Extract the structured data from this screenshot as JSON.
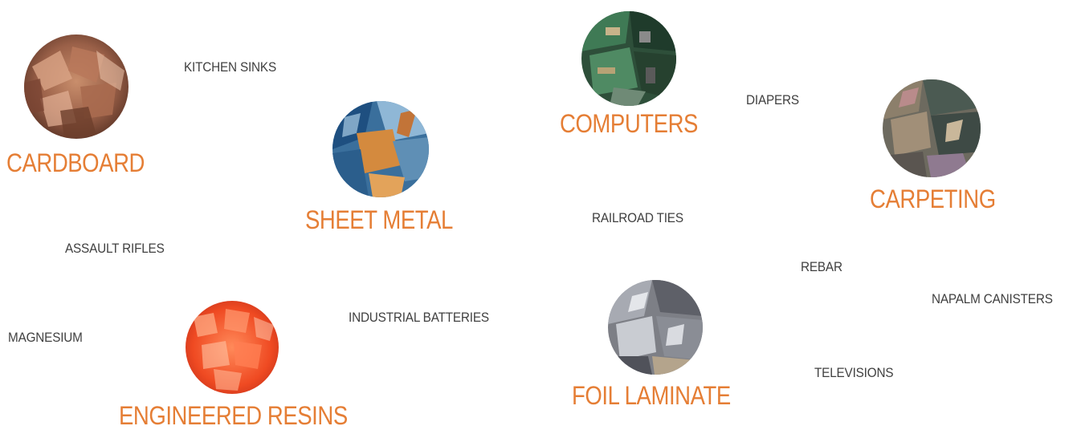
{
  "featured_materials": {
    "cardboard": {
      "label": "CARDBOARD",
      "image": "shredded-cardboard-photo"
    },
    "sheet_metal": {
      "label": "SHEET METAL",
      "image": "scrap-sheet-metal-photo"
    },
    "computers": {
      "label": "COMPUTERS",
      "image": "circuit-board-scrap-photo"
    },
    "carpeting": {
      "label": "CARPETING",
      "image": "shredded-carpet-photo"
    },
    "engineered_resins": {
      "label": "ENGINEERED RESINS",
      "image": "resin-pellets-photo"
    },
    "foil_laminate": {
      "label": "FOIL LAMINATE",
      "image": "crushed-foil-photo"
    }
  },
  "other_materials": {
    "kitchen_sinks": "KITCHEN SINKS",
    "diapers": "DIAPERS",
    "railroad_ties": "RAILROAD TIES",
    "assault_rifles": "ASSAULT RIFLES",
    "rebar": "REBAR",
    "napalm_canisters": "NAPALM CANISTERS",
    "magnesium": "MAGNESIUM",
    "industrial_batteries": "INDUSTRIAL BATTERIES",
    "televisions": "TELEVISIONS"
  },
  "colors": {
    "featured_label": "#e57e35",
    "small_label": "#404040",
    "background": "#ffffff"
  }
}
